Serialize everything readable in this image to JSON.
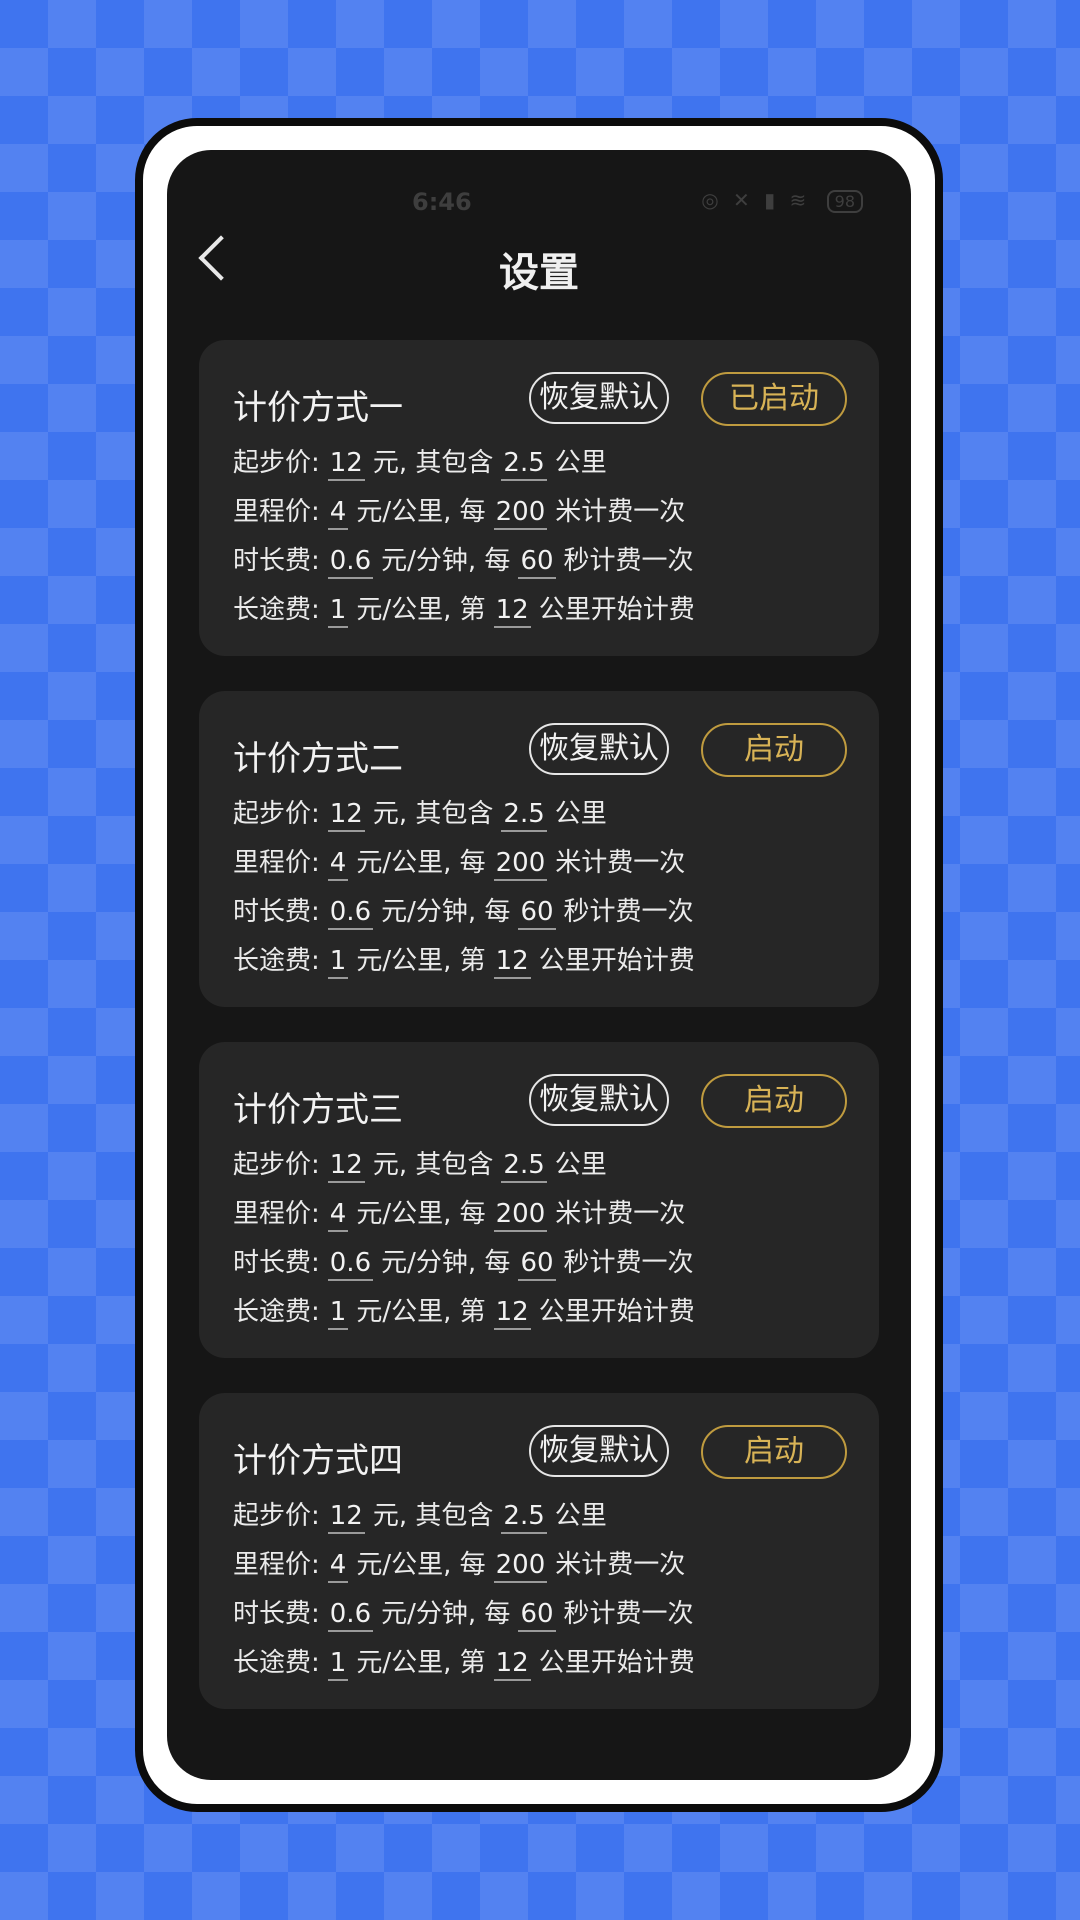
{
  "status_bar": {
    "time": "6:46",
    "icons": "◎ ✕ ▮ ≋",
    "battery": "98"
  },
  "header": {
    "title": "设置"
  },
  "labels": {
    "base": "起步价:",
    "yuan": "元,",
    "includes": "其包含",
    "km": "公里",
    "mileage": "里程价:",
    "yuan_per_km": "元/公里,",
    "every": "每",
    "meter_suffix": "米计费一次",
    "duration": "时长费:",
    "yuan_per_min": "元/分钟,",
    "second_suffix": "秒计费一次",
    "long": "长途费:",
    "nth": "第",
    "km_start": "公里开始计费"
  },
  "cards": [
    {
      "title": "计价方式一",
      "reset_label": "恢复默认",
      "start_label": "已启动",
      "base_price": "12",
      "base_km": "2.5",
      "mileage_price": "4",
      "mileage_meters": "200",
      "time_price": "0.6",
      "time_seconds": "60",
      "long_price": "1",
      "long_km": "12"
    },
    {
      "title": "计价方式二",
      "reset_label": "恢复默认",
      "start_label": "启动",
      "base_price": "12",
      "base_km": "2.5",
      "mileage_price": "4",
      "mileage_meters": "200",
      "time_price": "0.6",
      "time_seconds": "60",
      "long_price": "1",
      "long_km": "12"
    },
    {
      "title": "计价方式三",
      "reset_label": "恢复默认",
      "start_label": "启动",
      "base_price": "12",
      "base_km": "2.5",
      "mileage_price": "4",
      "mileage_meters": "200",
      "time_price": "0.6",
      "time_seconds": "60",
      "long_price": "1",
      "long_km": "12"
    },
    {
      "title": "计价方式四",
      "reset_label": "恢复默认",
      "start_label": "启动",
      "base_price": "12",
      "base_km": "2.5",
      "mileage_price": "4",
      "mileage_meters": "200",
      "time_price": "0.6",
      "time_seconds": "60",
      "long_price": "1",
      "long_km": "12"
    }
  ],
  "colors": {
    "background_blue": "#3f74ef",
    "screen": "#161616",
    "card": "#262626",
    "accent_gold": "#d8b356"
  },
  "icons": {
    "back": "chevron-left-icon"
  }
}
